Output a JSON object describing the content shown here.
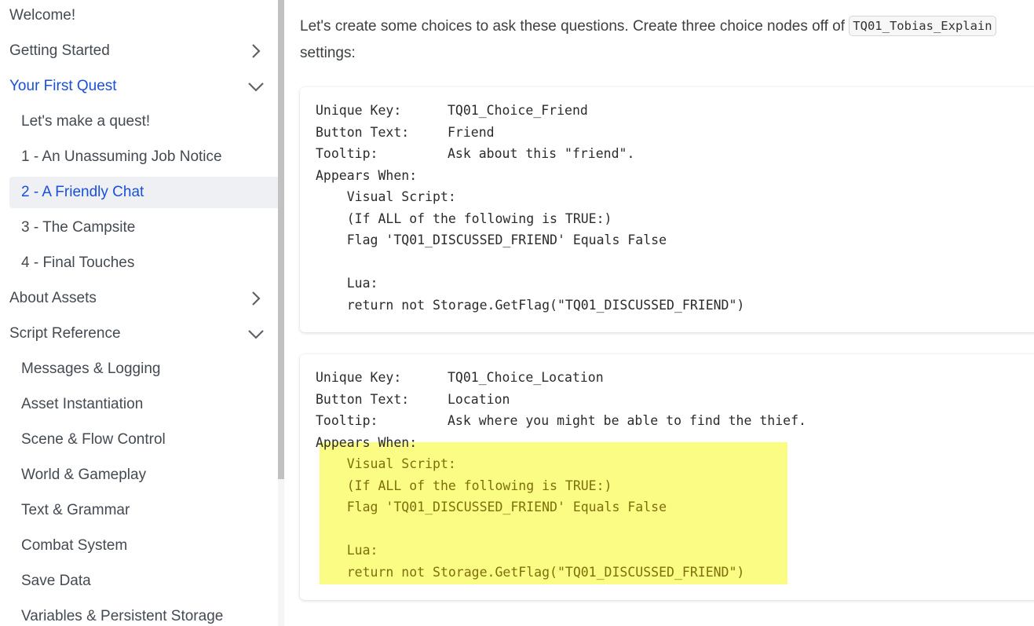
{
  "sidebar": {
    "items": [
      {
        "label": "Welcome!",
        "level": 0,
        "chevron": "none"
      },
      {
        "label": "Getting Started",
        "level": 0,
        "chevron": "right"
      },
      {
        "label": "Your First Quest",
        "level": 0,
        "chevron": "down",
        "active": true
      },
      {
        "label": "Let's make a quest!",
        "level": 1
      },
      {
        "label": "1 - An Unassuming Job Notice",
        "level": 1
      },
      {
        "label": "2 - A Friendly Chat",
        "level": 1,
        "active": true,
        "selected": true
      },
      {
        "label": "3 - The Campsite",
        "level": 1
      },
      {
        "label": "4 - Final Touches",
        "level": 1
      },
      {
        "label": "About Assets",
        "level": 0,
        "chevron": "right"
      },
      {
        "label": "Script Reference",
        "level": 0,
        "chevron": "down"
      },
      {
        "label": "Messages & Logging",
        "level": 1
      },
      {
        "label": "Asset Instantiation",
        "level": 1
      },
      {
        "label": "Scene & Flow Control",
        "level": 1
      },
      {
        "label": "World & Gameplay",
        "level": 1
      },
      {
        "label": "Text & Grammar",
        "level": 1
      },
      {
        "label": "Combat System",
        "level": 1
      },
      {
        "label": "Save Data",
        "level": 1
      },
      {
        "label": "Variables & Persistent Storage",
        "level": 1
      }
    ],
    "icons": {
      "chevron_right": "chevron-right-icon",
      "chevron_down": "chevron-down-icon"
    }
  },
  "content": {
    "intro_before": "Let's create some choices to ask these questions. Create three choice nodes off of ",
    "intro_code": "TQ01_Tobias_Explain",
    "intro_after": "settings:",
    "blocks": [
      {
        "lines": [
          {
            "key": "Unique Key:",
            "value": "TQ01_Choice_Friend"
          },
          {
            "key": "Button Text:",
            "value": "Friend"
          },
          {
            "key": "Tooltip:",
            "value": "Ask about this \"friend\"."
          },
          {
            "key": "Appears When:",
            "value": ""
          },
          {
            "key": "    Visual Script:",
            "value": ""
          },
          {
            "key": "    (If ALL of the following is TRUE:)",
            "value": ""
          },
          {
            "key": "    Flag 'TQ01_DISCUSSED_FRIEND' Equals False",
            "value": ""
          },
          {
            "key": "",
            "value": ""
          },
          {
            "key": "    Lua:",
            "value": ""
          },
          {
            "key": "    return not Storage.GetFlag(\"TQ01_DISCUSSED_FRIEND\")",
            "value": ""
          }
        ]
      },
      {
        "lines": [
          {
            "key": "Unique Key:",
            "value": "TQ01_Choice_Location"
          },
          {
            "key": "Button Text:",
            "value": "Location"
          },
          {
            "key": "Tooltip:",
            "value": "Ask where you might be able to find the thief."
          },
          {
            "key": "Appears When:",
            "value": ""
          },
          {
            "key": "    Visual Script:",
            "value": "",
            "highlight": true
          },
          {
            "key": "    (If ALL of the following is TRUE:)",
            "value": "",
            "highlight": true
          },
          {
            "key": "    Flag 'TQ01_DISCUSSED_FRIEND' Equals False",
            "value": "",
            "highlight": true
          },
          {
            "key": "",
            "value": "",
            "highlight": true
          },
          {
            "key": "    Lua:",
            "value": "",
            "highlight": true
          },
          {
            "key": "    return not Storage.GetFlag(\"TQ01_DISCUSSED_FRIEND\")",
            "value": "",
            "highlight": true
          }
        ]
      }
    ]
  },
  "colors": {
    "accent": "#1a4fd8",
    "highlight": "#fbfc84",
    "selected_bg": "#eef0f3"
  }
}
